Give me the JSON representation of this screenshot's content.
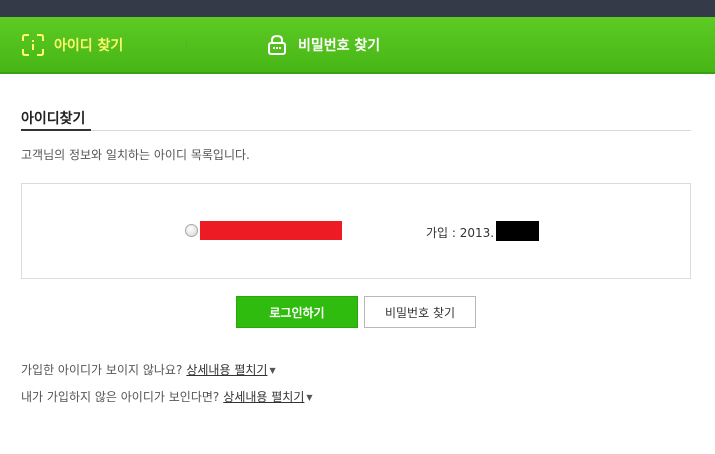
{
  "tabs": {
    "find_id": {
      "label": "아이디 찾기",
      "icon": "id-scan-icon",
      "color": "#fff86a"
    },
    "find_password": {
      "label": "비밀번호 찾기",
      "icon": "password-lock-icon",
      "color": "#ffffff"
    }
  },
  "section": {
    "title": "아이디찾기",
    "description": "고객님의 정보와 일치하는 아이디 목록입니다."
  },
  "result": {
    "join_label": "가입 : 2013.",
    "id_redaction_color": "#ed1c24",
    "date_redaction_color": "#000000"
  },
  "buttons": {
    "login": "로그인하기",
    "find_password": "비밀번호 찾기"
  },
  "help": {
    "not_visible_question": "가입한 아이디가 보이지 않나요?",
    "not_visible_link": "상세내용 펼치기",
    "not_mine_question": "내가 가입하지 않은 아이디가 보인다면?",
    "not_mine_link": "상세내용 펼치기"
  },
  "colors": {
    "tab_bar": "#4fbd1b",
    "primary_button": "#2fbc0f",
    "top_bar": "#343a48"
  }
}
